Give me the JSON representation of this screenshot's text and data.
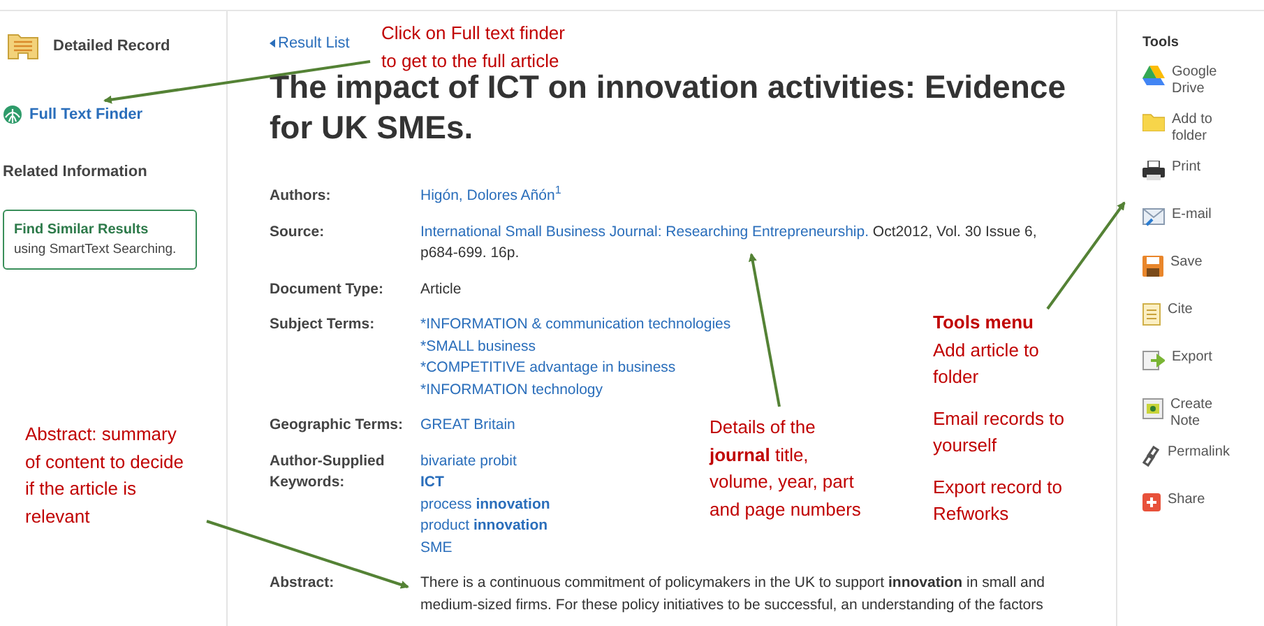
{
  "sidebar": {
    "detailed_record": "Detailed Record",
    "full_text_finder": "Full Text Finder",
    "related_heading": "Related Information",
    "similar": {
      "title": "Find Similar Results",
      "subtitle": "using SmartText Searching."
    }
  },
  "record": {
    "back_link": "Result List",
    "title": "The impact of ICT on innovation activities: Evidence for UK SMEs.",
    "fields": [
      {
        "label": "Authors:",
        "kind": "text",
        "value": "Higón, Dolores Añón$^{1}$",
        "link": true
      },
      {
        "label": "Source:",
        "kind": "source",
        "link_text": "International Small Business Journal: Researching Entrepreneurship.",
        "rest": "Oct2012, Vol. 30 Issue 6, p684-699. 16p."
      },
      {
        "label": "Document Type:",
        "kind": "text",
        "value": "Article",
        "link": false
      },
      {
        "label": "Subject Terms:",
        "kind": "list",
        "items": [
          "*INFORMATION & communication technologies",
          "*SMALL business",
          "*COMPETITIVE advantage in business",
          "*INFORMATION technology"
        ]
      },
      {
        "label": "Geographic Terms:",
        "kind": "text",
        "value": "GREAT Britain",
        "link": true
      },
      {
        "label": "Author-Supplied Keywords:",
        "kind": "list",
        "items": [
          "bivariate probit",
          "**ICT**",
          "process **innovation**",
          "product **innovation**",
          "SME"
        ]
      },
      {
        "label": "Abstract:",
        "kind": "text",
        "value": "There is a continuous commitment of policymakers in the UK to support **innovation** in small and medium-sized firms. For these policy initiatives to be successful, an understanding of the factors",
        "link": false
      }
    ]
  },
  "tools": {
    "heading": "Tools",
    "items": [
      {
        "kind": "drive",
        "label": "Google Drive"
      },
      {
        "kind": "folder",
        "label": "Add to folder"
      },
      {
        "kind": "print",
        "label": "Print"
      },
      {
        "kind": "email",
        "label": "E-mail"
      },
      {
        "kind": "save",
        "label": "Save"
      },
      {
        "kind": "cite",
        "label": "Cite"
      },
      {
        "kind": "export",
        "label": "Export"
      },
      {
        "kind": "note",
        "label": "Create Note"
      },
      {
        "kind": "link",
        "label": "Permalink"
      },
      {
        "kind": "share",
        "label": "Share"
      }
    ]
  },
  "callouts": [
    {
      "text": "Click on Full text finder to get to the full article"
    },
    {
      "text": "Abstract: summary of content to decide if the article is relevant"
    },
    {
      "text": "Details of the **journal** title, volume, year, part and page numbers"
    }
  ],
  "tools_note": {
    "title": "Tools menu",
    "notes": [
      "Add article to folder",
      "Email records to yourself",
      "Export record to Refworks"
    ]
  }
}
